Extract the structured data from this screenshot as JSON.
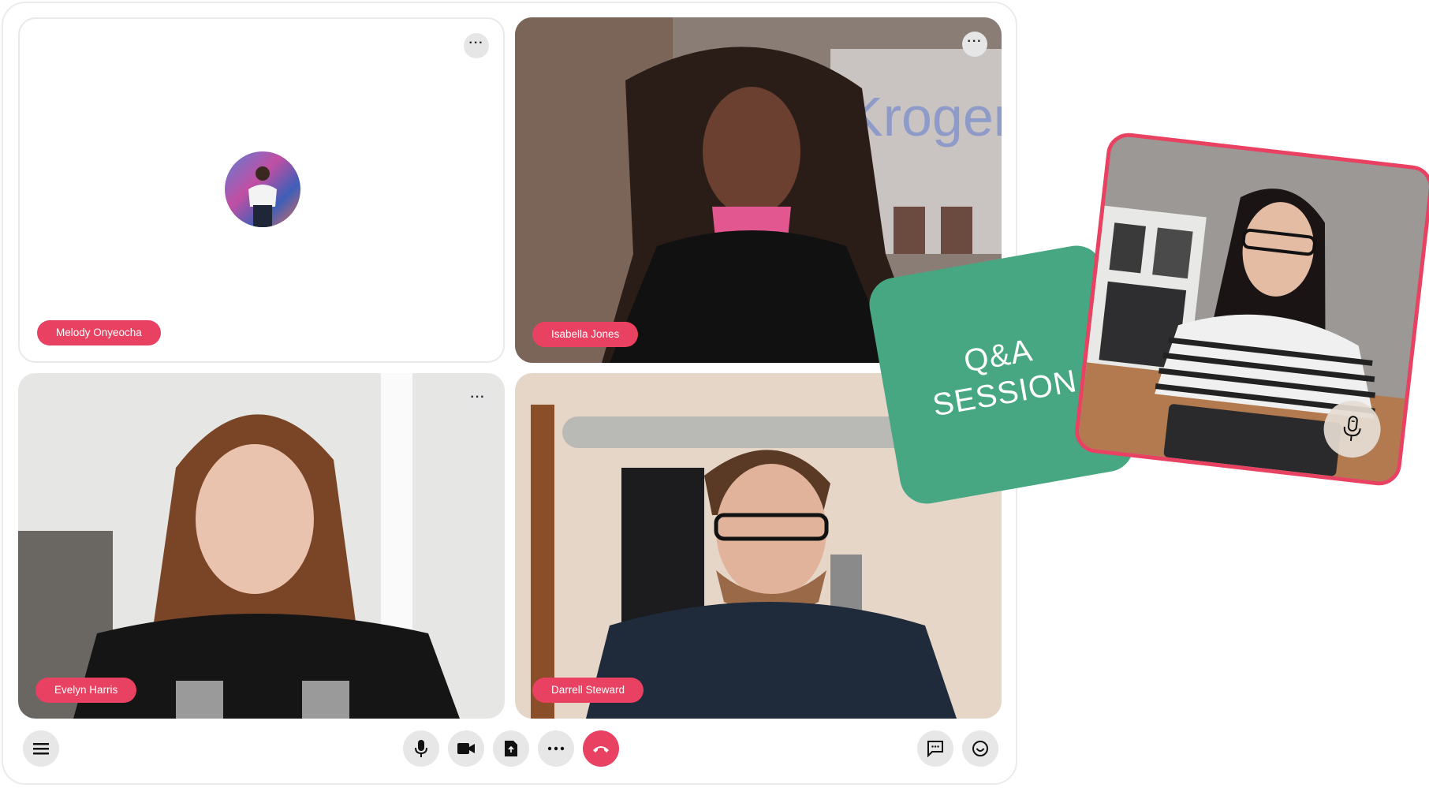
{
  "participants": [
    {
      "name": "Melody Onyeocha",
      "video_on": false,
      "has_avatar": true
    },
    {
      "name": "Isabella Jones",
      "video_on": true
    },
    {
      "name": "Evelyn Harris",
      "video_on": true
    },
    {
      "name": "Darrell Steward",
      "video_on": true
    }
  ],
  "tile_menu_icon": "more-horizontal-icon",
  "toolbar": {
    "left": [
      {
        "icon": "menu-icon",
        "label": "Menu"
      }
    ],
    "center": [
      {
        "icon": "microphone-icon",
        "label": "Microphone"
      },
      {
        "icon": "video-camera-icon",
        "label": "Camera"
      },
      {
        "icon": "share-screen-icon",
        "label": "Share"
      },
      {
        "icon": "more-horizontal-icon",
        "label": "More"
      },
      {
        "icon": "end-call-icon",
        "label": "Leave call"
      }
    ],
    "right": [
      {
        "icon": "chat-icon",
        "label": "Chat"
      },
      {
        "icon": "emoji-icon",
        "label": "Reactions"
      }
    ]
  },
  "qa_card": {
    "line1": "Q&A",
    "line2": "SESSION"
  },
  "floating_speaker": {
    "mic_icon": "microphone-icon"
  },
  "colors": {
    "accent": "#e84161",
    "qa_green": "#48a783",
    "button_grey": "#e7e7e7"
  }
}
